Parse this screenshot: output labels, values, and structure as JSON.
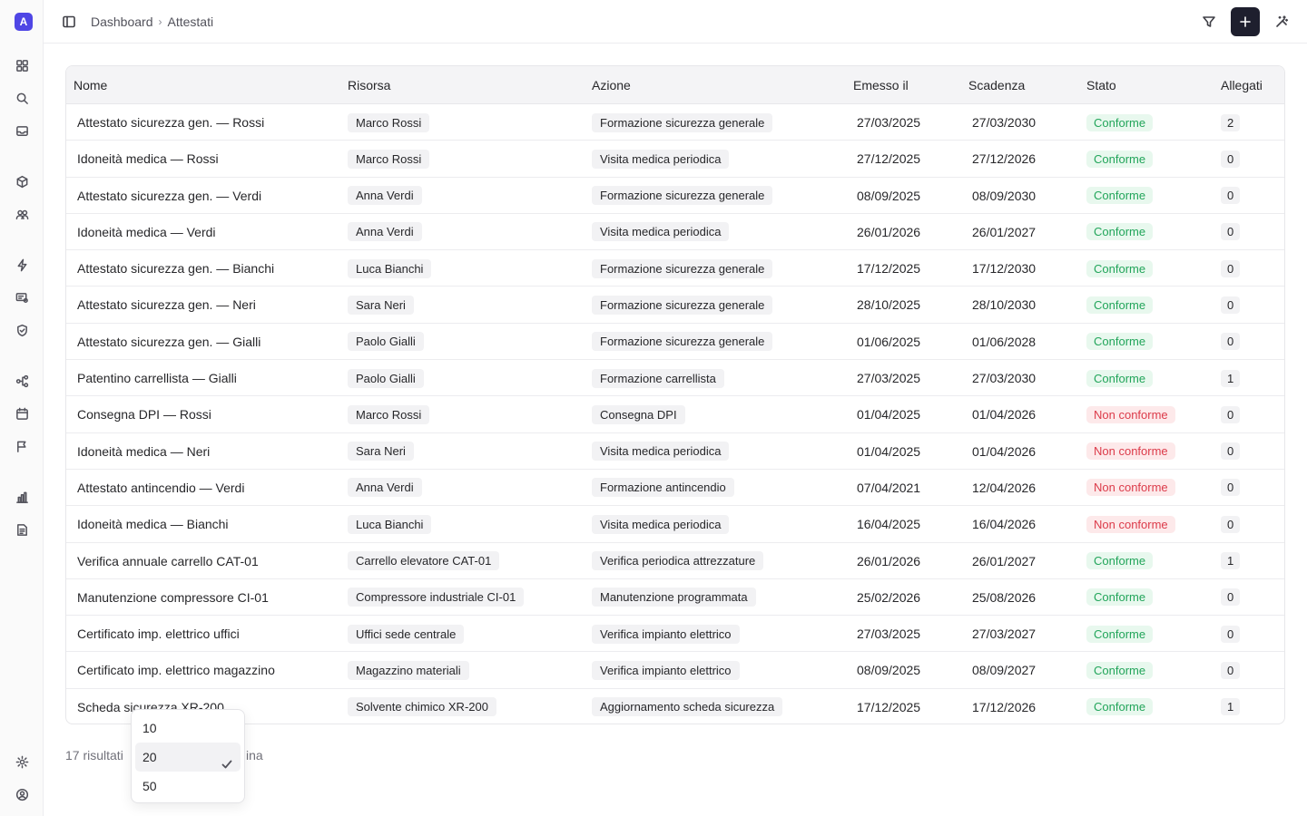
{
  "app": {
    "logo_letter": "A"
  },
  "breadcrumb": [
    "Dashboard",
    "Attestati"
  ],
  "columns": {
    "nome": "Nome",
    "risorsa": "Risorsa",
    "azione": "Azione",
    "emesso": "Emesso il",
    "scadenza": "Scadenza",
    "stato": "Stato",
    "allegati": "Allegati"
  },
  "rows": [
    {
      "nome": "Attestato sicurezza gen. — Rossi",
      "risorsa": "Marco Rossi",
      "azione": "Formazione sicurezza generale",
      "emesso": "27/03/2025",
      "scadenza": "27/03/2030",
      "stato": "Conforme",
      "allegati": "2"
    },
    {
      "nome": "Idoneità medica — Rossi",
      "risorsa": "Marco Rossi",
      "azione": "Visita medica periodica",
      "emesso": "27/12/2025",
      "scadenza": "27/12/2026",
      "stato": "Conforme",
      "allegati": "0"
    },
    {
      "nome": "Attestato sicurezza gen. — Verdi",
      "risorsa": "Anna Verdi",
      "azione": "Formazione sicurezza generale",
      "emesso": "08/09/2025",
      "scadenza": "08/09/2030",
      "stato": "Conforme",
      "allegati": "0"
    },
    {
      "nome": "Idoneità medica — Verdi",
      "risorsa": "Anna Verdi",
      "azione": "Visita medica periodica",
      "emesso": "26/01/2026",
      "scadenza": "26/01/2027",
      "stato": "Conforme",
      "allegati": "0"
    },
    {
      "nome": "Attestato sicurezza gen. — Bianchi",
      "risorsa": "Luca Bianchi",
      "azione": "Formazione sicurezza generale",
      "emesso": "17/12/2025",
      "scadenza": "17/12/2030",
      "stato": "Conforme",
      "allegati": "0"
    },
    {
      "nome": "Attestato sicurezza gen. — Neri",
      "risorsa": "Sara Neri",
      "azione": "Formazione sicurezza generale",
      "emesso": "28/10/2025",
      "scadenza": "28/10/2030",
      "stato": "Conforme",
      "allegati": "0"
    },
    {
      "nome": "Attestato sicurezza gen. — Gialli",
      "risorsa": "Paolo Gialli",
      "azione": "Formazione sicurezza generale",
      "emesso": "01/06/2025",
      "scadenza": "01/06/2028",
      "stato": "Conforme",
      "allegati": "0"
    },
    {
      "nome": "Patentino carrellista — Gialli",
      "risorsa": "Paolo Gialli",
      "azione": "Formazione carrellista",
      "emesso": "27/03/2025",
      "scadenza": "27/03/2030",
      "stato": "Conforme",
      "allegati": "1"
    },
    {
      "nome": "Consegna DPI — Rossi",
      "risorsa": "Marco Rossi",
      "azione": "Consegna DPI",
      "emesso": "01/04/2025",
      "scadenza": "01/04/2026",
      "stato": "Non conforme",
      "allegati": "0"
    },
    {
      "nome": "Idoneità medica — Neri",
      "risorsa": "Sara Neri",
      "azione": "Visita medica periodica",
      "emesso": "01/04/2025",
      "scadenza": "01/04/2026",
      "stato": "Non conforme",
      "allegati": "0"
    },
    {
      "nome": "Attestato antincendio — Verdi",
      "risorsa": "Anna Verdi",
      "azione": "Formazione antincendio",
      "emesso": "07/04/2021",
      "scadenza": "12/04/2026",
      "stato": "Non conforme",
      "allegati": "0"
    },
    {
      "nome": "Idoneità medica — Bianchi",
      "risorsa": "Luca Bianchi",
      "azione": "Visita medica periodica",
      "emesso": "16/04/2025",
      "scadenza": "16/04/2026",
      "stato": "Non conforme",
      "allegati": "0"
    },
    {
      "nome": "Verifica annuale carrello CAT-01",
      "risorsa": "Carrello elevatore CAT-01",
      "azione": "Verifica periodica attrezzature",
      "emesso": "26/01/2026",
      "scadenza": "26/01/2027",
      "stato": "Conforme",
      "allegati": "1"
    },
    {
      "nome": "Manutenzione compressore CI-01",
      "risorsa": "Compressore industriale CI-01",
      "azione": "Manutenzione programmata",
      "emesso": "25/02/2026",
      "scadenza": "25/08/2026",
      "stato": "Conforme",
      "allegati": "0"
    },
    {
      "nome": "Certificato imp. elettrico uffici",
      "risorsa": "Uffici sede centrale",
      "azione": "Verifica impianto elettrico",
      "emesso": "27/03/2025",
      "scadenza": "27/03/2027",
      "stato": "Conforme",
      "allegati": "0"
    },
    {
      "nome": "Certificato imp. elettrico magazzino",
      "risorsa": "Magazzino materiali",
      "azione": "Verifica impianto elettrico",
      "emesso": "08/09/2025",
      "scadenza": "08/09/2027",
      "stato": "Conforme",
      "allegati": "0"
    },
    {
      "nome": "Scheda sicurezza XR-200",
      "risorsa": "Solvente chimico XR-200",
      "azione": "Aggiornamento scheda sicurezza",
      "emesso": "17/12/2025",
      "scadenza": "17/12/2026",
      "stato": "Conforme",
      "allegati": "1"
    }
  ],
  "footer": {
    "results": "17 risultati",
    "page_suffix": "ina"
  },
  "page_size": {
    "options": [
      "10",
      "20",
      "50"
    ],
    "selected": "20"
  },
  "colors": {
    "accent": "#4f46e5",
    "ok": "#22a55a",
    "ko": "#dc3b4a",
    "primary_button": "#1e1f2e"
  }
}
